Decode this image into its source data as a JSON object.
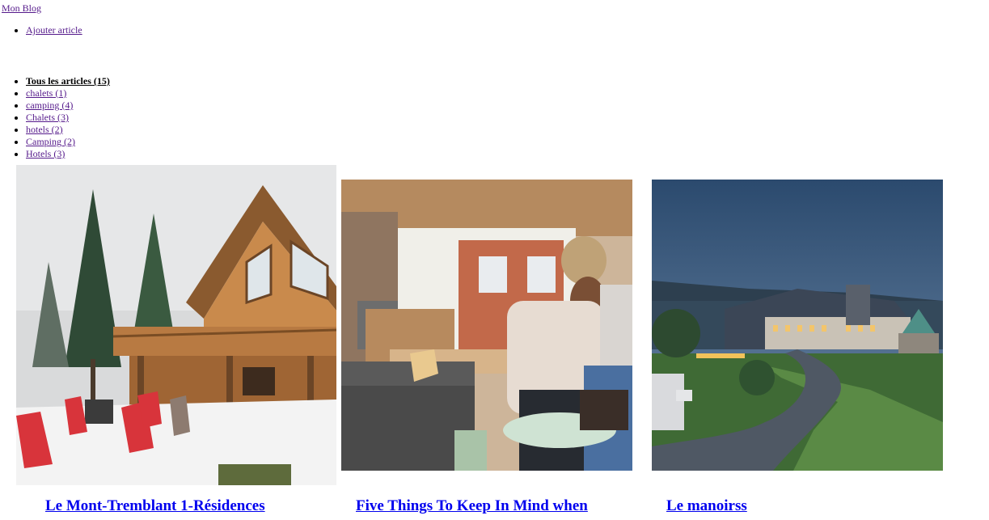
{
  "brand": {
    "label": "Mon Blog"
  },
  "nav": {
    "items": [
      {
        "label": "Ajouter article"
      }
    ]
  },
  "categories": [
    {
      "label": "Tous les articles (15)",
      "active": true
    },
    {
      "label": "chalets (1)"
    },
    {
      "label": "camping (4)"
    },
    {
      "label": "Chalets (3)"
    },
    {
      "label": "hotels (2)"
    },
    {
      "label": "Camping (2)"
    },
    {
      "label": "Hotels (3)"
    }
  ],
  "articles": [
    {
      "title": "Le Mont-Tremblant 1-Résidences",
      "image": "log-cabin-in-snow"
    },
    {
      "title": "Five Things To Keep In Mind when",
      "image": "cafe-two-women"
    },
    {
      "title": "Le manoirss",
      "image": "manor-at-dusk"
    }
  ],
  "colors": {
    "link": "#551a8b",
    "title": "#0000ee"
  }
}
